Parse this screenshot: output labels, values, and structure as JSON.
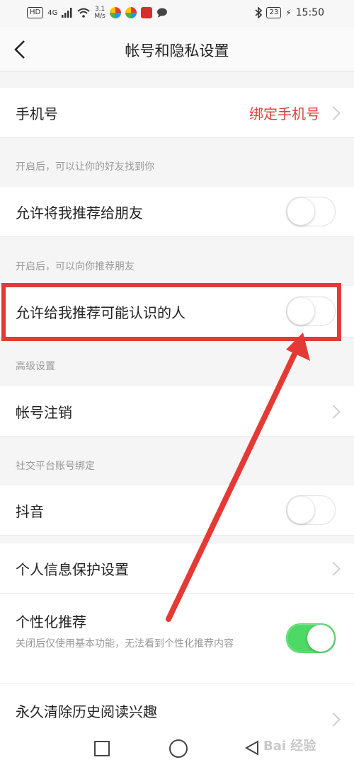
{
  "status_bar": {
    "network": "HD",
    "signal": "4G",
    "speed_value": "3.1",
    "speed_unit": "M/s",
    "battery": "23",
    "time": "15:50"
  },
  "header": {
    "title": "帐号和隐私设置"
  },
  "phone_row": {
    "label": "手机号",
    "value": "绑定手机号"
  },
  "section1": {
    "text": "开启后，可以让你的好友找到你"
  },
  "recommend_me_row": {
    "label": "允许将我推荐给朋友",
    "enabled": false
  },
  "section2": {
    "text": "开启后，可以向你推荐朋友"
  },
  "recommend_known_row": {
    "label": "允许给我推荐可能认识的人",
    "enabled": false
  },
  "section3": {
    "text": "高级设置"
  },
  "account_cancel_row": {
    "label": "帐号注销"
  },
  "section4": {
    "text": "社交平台账号绑定"
  },
  "douyin_row": {
    "label": "抖音",
    "enabled": false
  },
  "privacy_row": {
    "label": "个人信息保护设置"
  },
  "personalized_row": {
    "label": "个性化推荐",
    "desc": "关闭后仅使用基本功能，无法看到个性化推荐内容",
    "enabled": true
  },
  "clear_history_row": {
    "label": "永久清除历史阅读兴趣"
  },
  "watermark": {
    "text": "Bai 经验"
  },
  "colors": {
    "accent_red": "#d9423b",
    "toggle_on": "#4cd964",
    "annotation_red": "#e53935"
  }
}
